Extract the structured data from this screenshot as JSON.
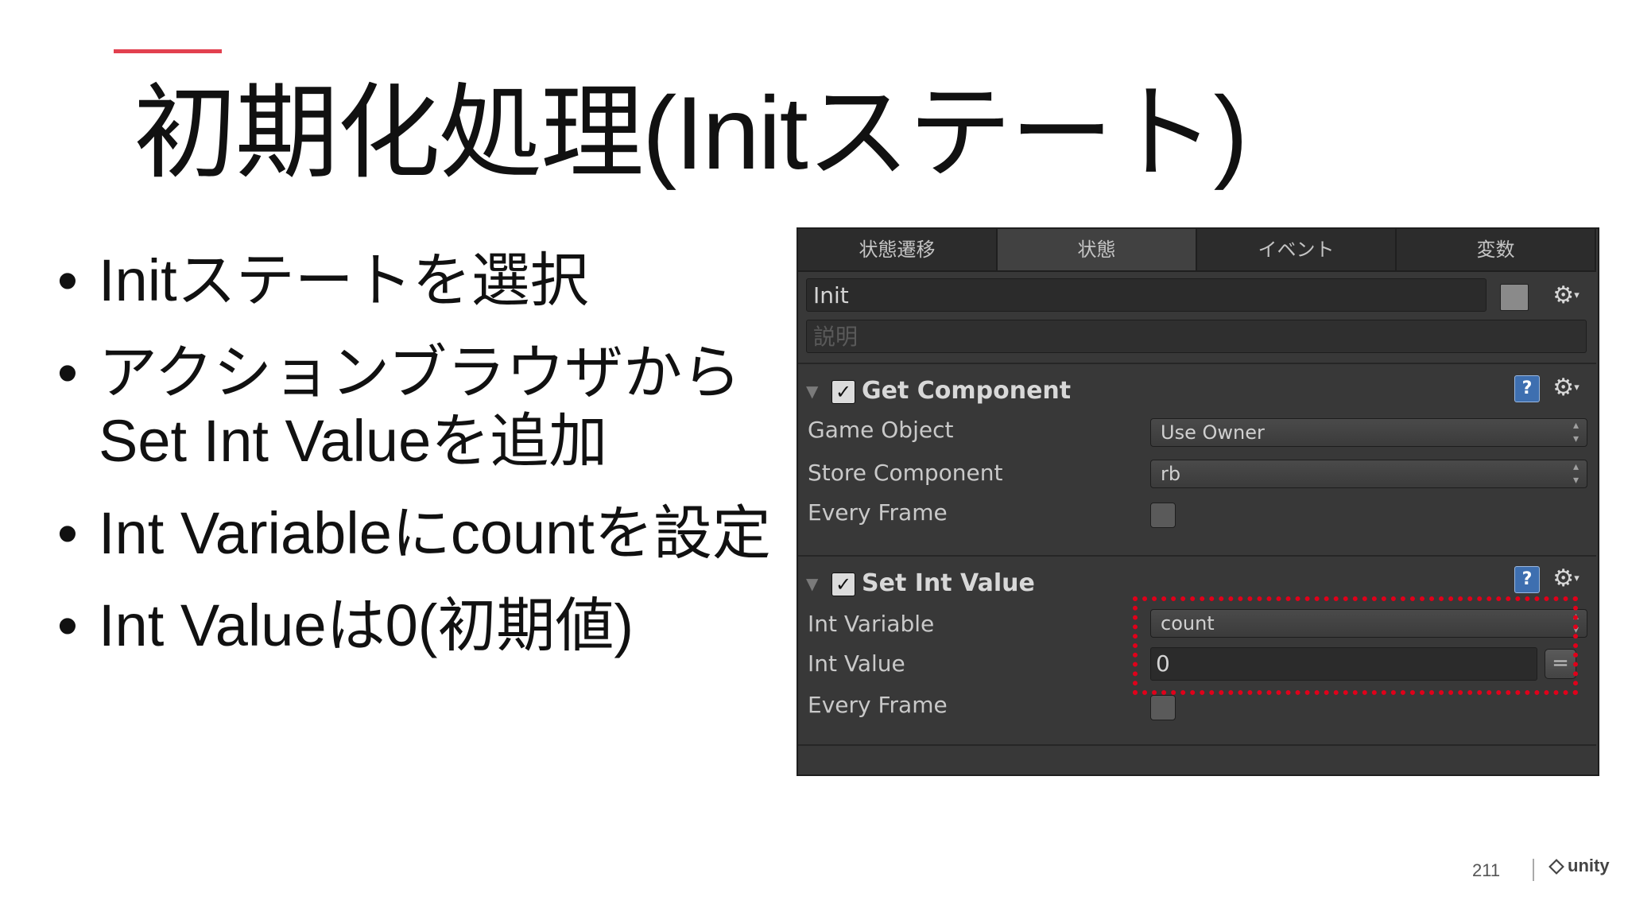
{
  "slide": {
    "accent_color": "#e2404f",
    "title": "初期化処理(Initステート)",
    "bullets": [
      "Initステートを選択",
      "アクションブラウザからSet Int Valueを追加",
      "Int Variableにcountを設定",
      "Int Valueは0(初期値)"
    ],
    "bullet_symbol": "•",
    "page_number": "211",
    "logo_text": "unity"
  },
  "panel": {
    "tabs": [
      "状態遷移",
      "状態",
      "イベント",
      "変数"
    ],
    "active_tab": "状態",
    "state_name": "Init",
    "description_placeholder": "説明",
    "actions": [
      {
        "title": "Get Component",
        "enabled": true,
        "properties": [
          {
            "label": "Game Object",
            "type": "dropdown",
            "value": "Use Owner"
          },
          {
            "label": "Store Component",
            "type": "dropdown",
            "value": "rb"
          },
          {
            "label": "Every Frame",
            "type": "checkbox",
            "checked": false
          }
        ]
      },
      {
        "title": "Set Int Value",
        "enabled": true,
        "properties": [
          {
            "label": "Int Variable",
            "type": "dropdown",
            "value": "count"
          },
          {
            "label": "Int Value",
            "type": "input",
            "value": "0"
          },
          {
            "label": "Every Frame",
            "type": "checkbox",
            "checked": false
          }
        ]
      }
    ],
    "icons": {
      "gear": "gear-icon",
      "help": "help-icon",
      "fold": "fold-triangle-icon",
      "check": "checkmark-icon",
      "equals": "equals-icon"
    },
    "highlight_color": "#e0001a"
  }
}
